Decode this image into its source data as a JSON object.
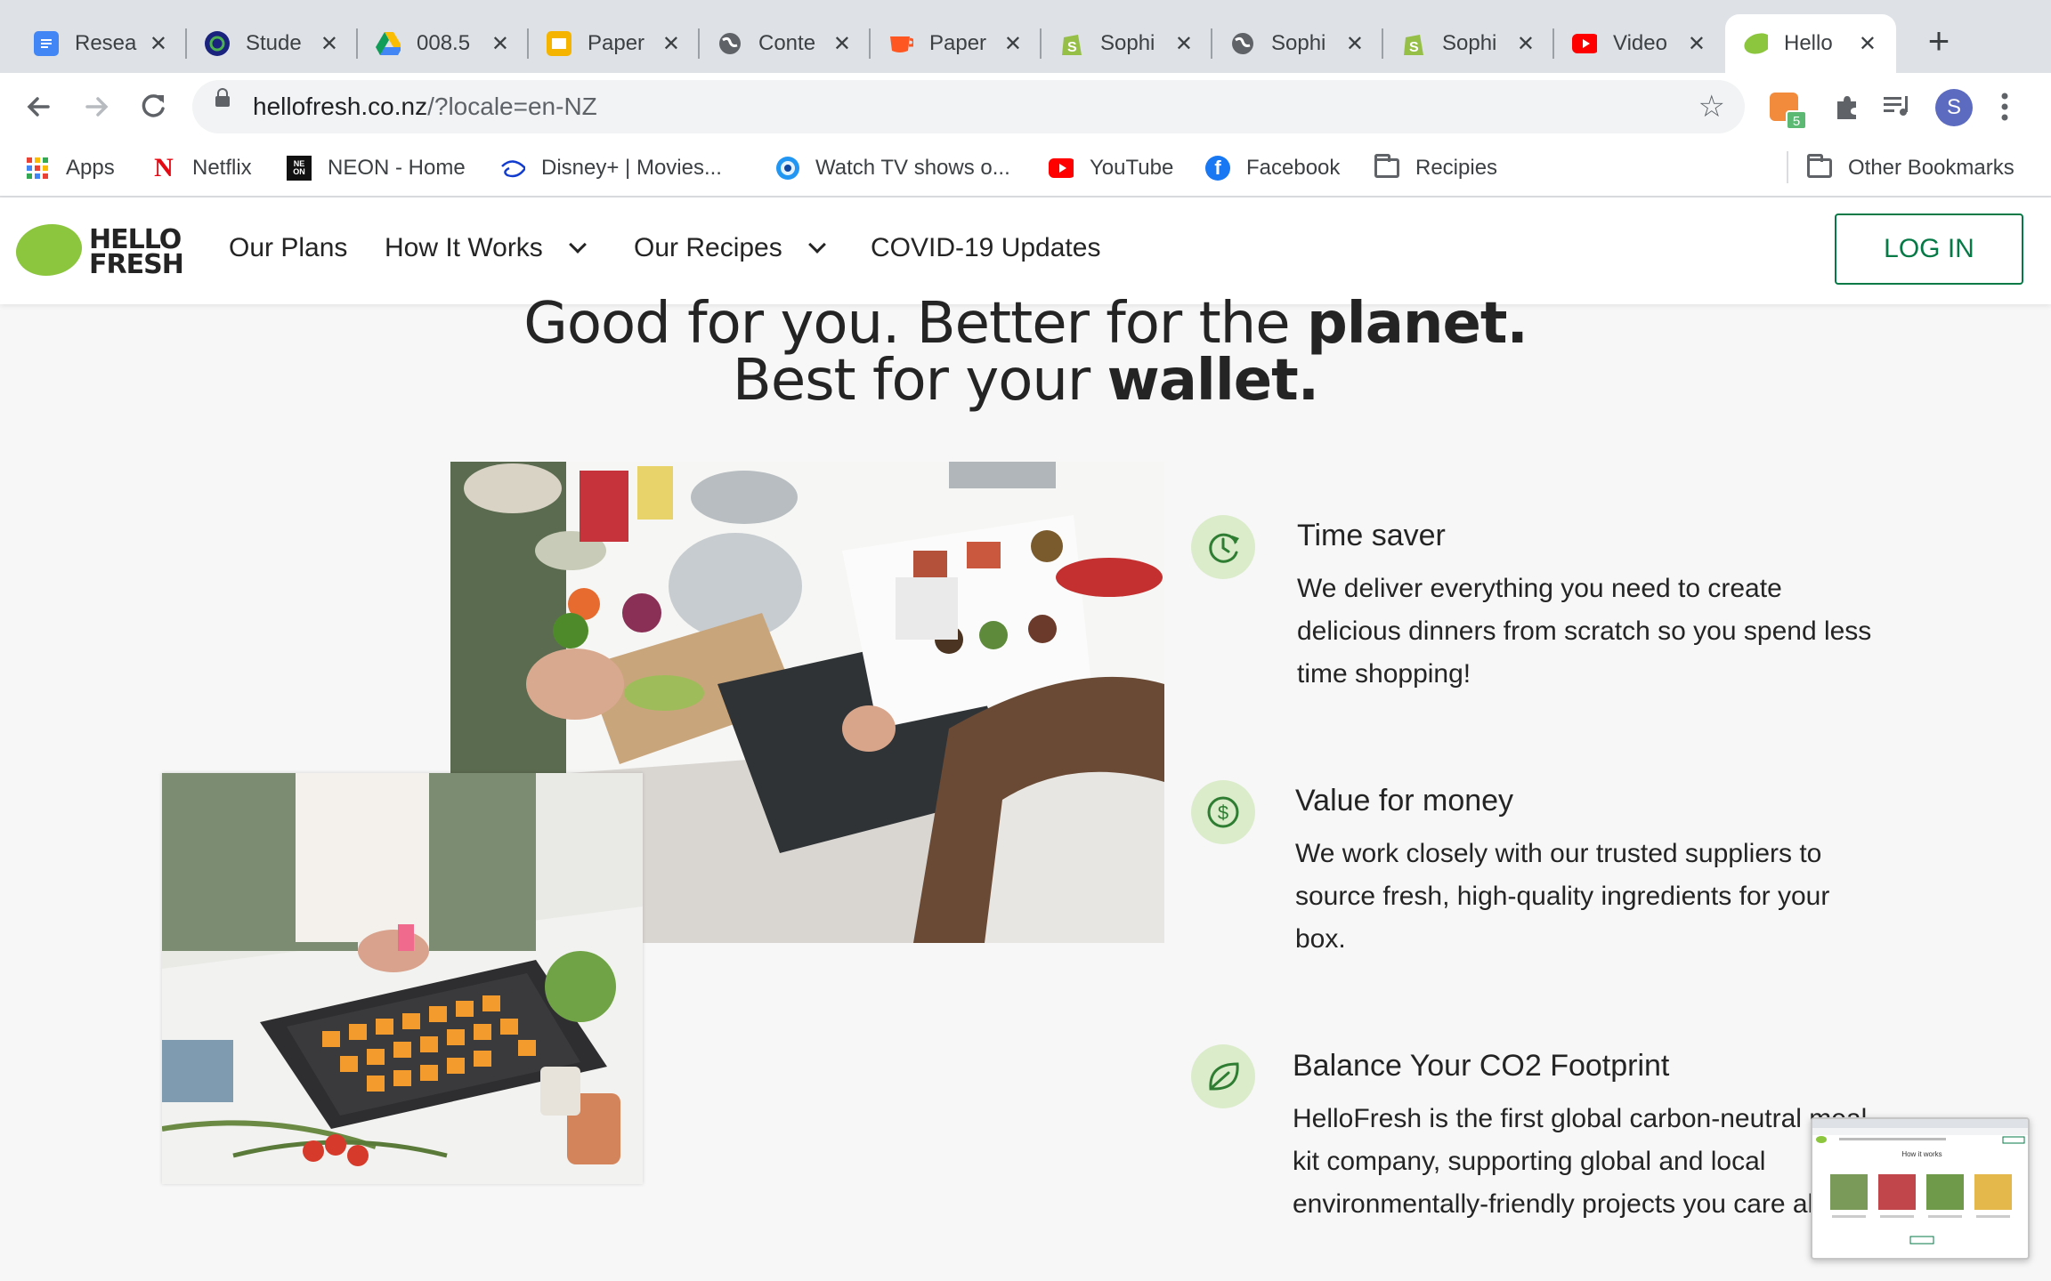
{
  "browser": {
    "tabs": [
      {
        "label": "Resea",
        "icon": "google-docs-icon",
        "color": "#4285f4"
      },
      {
        "label": "Stude",
        "icon": "student-portal-icon",
        "color": "#1a237e"
      },
      {
        "label": "008.5",
        "icon": "google-drive-icon",
        "color": "#0f9d58"
      },
      {
        "label": "Paper",
        "icon": "google-slides-icon",
        "color": "#f4b400"
      },
      {
        "label": "Conte",
        "icon": "globe-icon",
        "color": "#5f6368"
      },
      {
        "label": "Paper",
        "icon": "cup-icon",
        "color": "#ff5722"
      },
      {
        "label": "Sophi",
        "icon": "shopify-icon",
        "color": "#95bf47"
      },
      {
        "label": "Sophi",
        "icon": "globe-icon",
        "color": "#5f6368"
      },
      {
        "label": "Sophi",
        "icon": "shopify-icon",
        "color": "#95bf47"
      },
      {
        "label": "Video",
        "icon": "youtube-icon",
        "color": "#ff0000"
      },
      {
        "label": "Hello",
        "icon": "hellofresh-icon",
        "color": "#8cc63f"
      }
    ],
    "close_glyph": "✕",
    "new_tab_glyph": "+",
    "url_host": "hellofresh.co.nz",
    "url_path": "/?locale=en-NZ",
    "extension_badge": "5",
    "profile_initial": "S",
    "bookmarks": [
      {
        "label": "Apps",
        "icon": "apps-grid-icon"
      },
      {
        "label": "Netflix",
        "icon": "netflix-icon"
      },
      {
        "label": "NEON - Home",
        "icon": "neon-icon"
      },
      {
        "label": "Disney+ | Movies...",
        "icon": "disney-plus-icon"
      },
      {
        "label": "Watch TV shows o...",
        "icon": "tv-shows-icon"
      },
      {
        "label": "YouTube",
        "icon": "youtube-icon"
      },
      {
        "label": "Facebook",
        "icon": "facebook-icon"
      },
      {
        "label": "Recipies",
        "icon": "folder-icon"
      }
    ],
    "other_bookmarks": "Other Bookmarks"
  },
  "site": {
    "brand_color": "#067a46",
    "logo_line1": "HELLO",
    "logo_line2": "FRESH",
    "nav": [
      {
        "label": "Our Plans"
      },
      {
        "label": "How It Works"
      },
      {
        "label": "Our Recipes"
      },
      {
        "label": "COVID-19 Updates"
      }
    ],
    "login_label": "LOG IN"
  },
  "main": {
    "headline_line1_a": "Good for you. Better for the ",
    "headline_line1_b": "planet.",
    "headline_line2_a": "Best for your ",
    "headline_line2_b": "wallet.",
    "features": [
      {
        "icon": "clock-refresh-icon",
        "title": "Time saver",
        "body": "We deliver everything you need to create delicious dinners from scratch so you spend less time shopping!"
      },
      {
        "icon": "dollar-coin-icon",
        "title": "Value for money",
        "body": "We work closely with our trusted suppliers to source fresh, high-quality ingredients for your box."
      },
      {
        "icon": "leaf-icon",
        "title": "Balance Your CO2 Footprint",
        "body": "HelloFresh is the first global carbon-neutral meal kit company, supporting global and local environmentally-friendly projects you care about."
      }
    ],
    "preview_title": "How it works"
  }
}
